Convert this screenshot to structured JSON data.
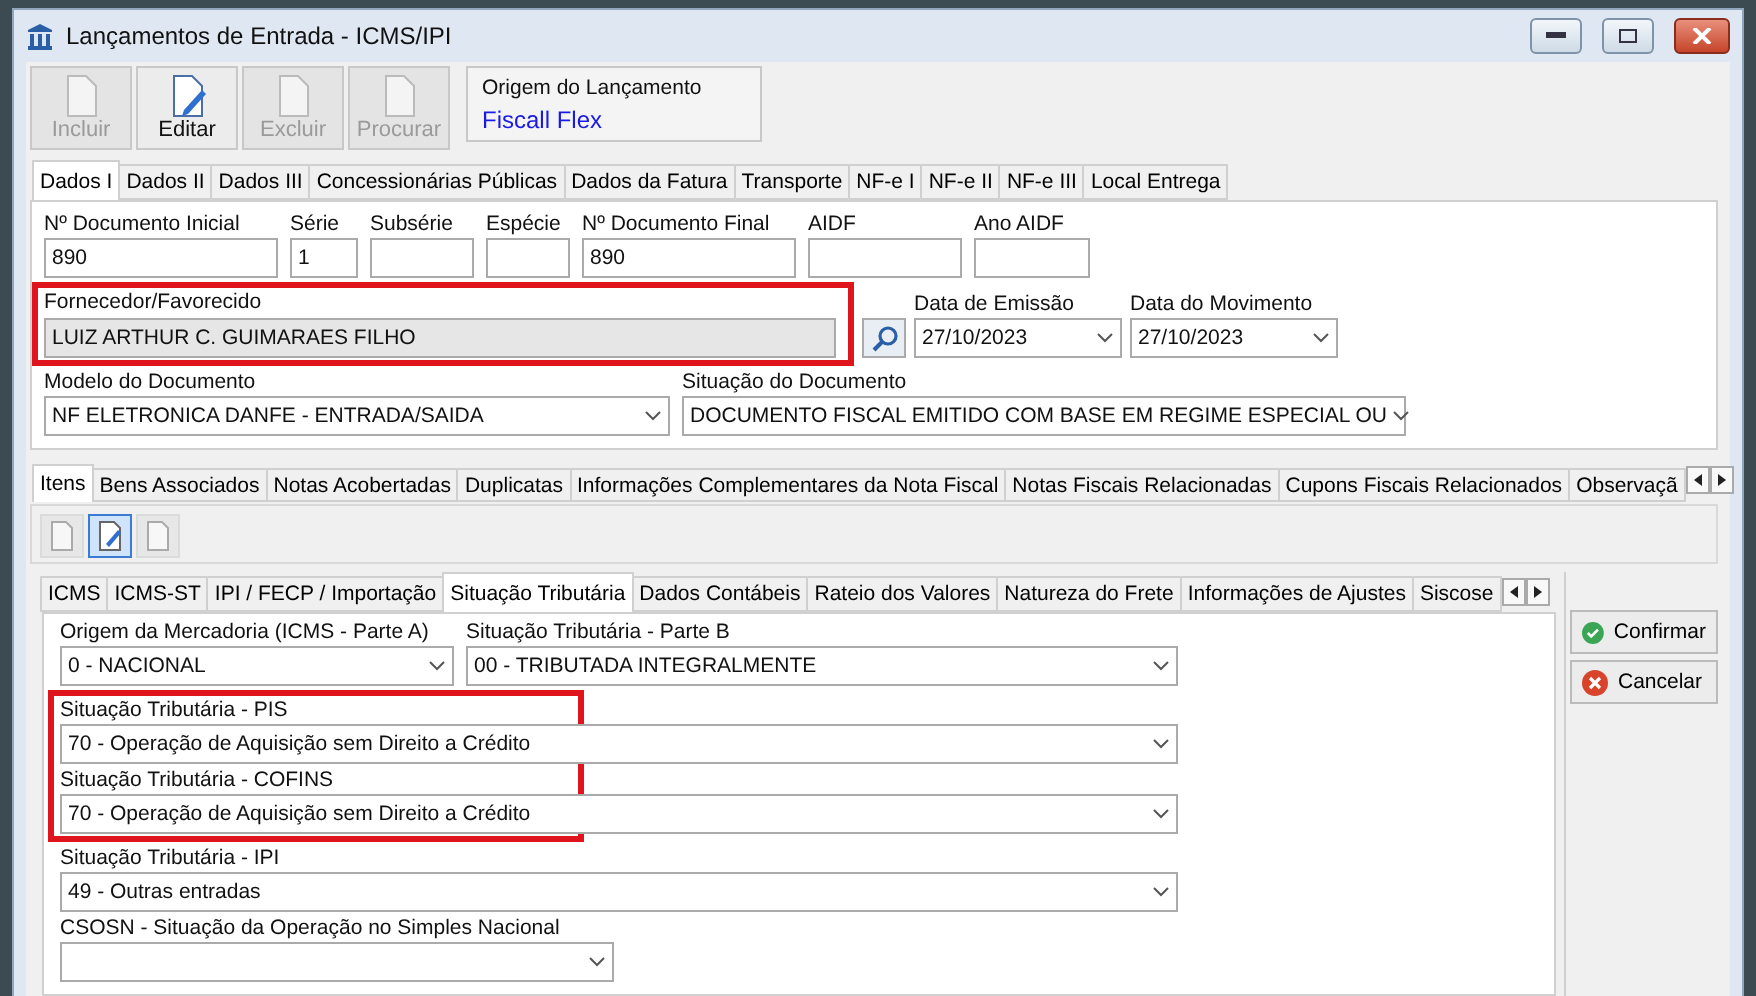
{
  "window": {
    "title": "Lançamentos de Entrada - ICMS/IPI"
  },
  "toolbar": {
    "buttons": [
      {
        "label": "Incluir",
        "disabled": true
      },
      {
        "label": "Editar",
        "disabled": false
      },
      {
        "label": "Excluir",
        "disabled": true
      },
      {
        "label": "Procurar",
        "disabled": true
      }
    ],
    "origin": {
      "label": "Origem do Lançamento",
      "value": "Fiscall Flex"
    }
  },
  "main_tabs": [
    {
      "label": "Dados I",
      "selected": true
    },
    {
      "label": "Dados II",
      "selected": false
    },
    {
      "label": "Dados III",
      "selected": false
    },
    {
      "label": "Concessionárias Públicas",
      "selected": false
    },
    {
      "label": "Dados da Fatura",
      "selected": false
    },
    {
      "label": "Transporte",
      "selected": false
    },
    {
      "label": "NF-e I",
      "selected": false
    },
    {
      "label": "NF-e II",
      "selected": false
    },
    {
      "label": "NF-e III",
      "selected": false
    },
    {
      "label": "Local Entrega",
      "selected": false
    }
  ],
  "document_fields": [
    {
      "label": "Nº Documento Inicial",
      "value": "890"
    },
    {
      "label": "Série",
      "value": "1"
    },
    {
      "label": "Subsérie"
    },
    {
      "label": "Espécie"
    },
    {
      "label": "Nº Documento Final",
      "value": "890"
    },
    {
      "label": "AIDF"
    },
    {
      "label": "Ano AIDF"
    }
  ],
  "supplier": {
    "label": "Fornecedor/Favorecido",
    "value": "LUIZ ARTHUR C. GUIMARAES FILHO",
    "highlighted": true
  },
  "dates": [
    {
      "label": "Data de Emissão",
      "value": "27/10/2023"
    },
    {
      "label": "Data do Movimento",
      "value": "27/10/2023"
    }
  ],
  "document_selects": [
    {
      "label": "Modelo do Documento",
      "value": "NF ELETRONICA DANFE - ENTRADA/SAIDA"
    },
    {
      "label": "Situação do Documento",
      "value": "DOCUMENTO FISCAL EMITIDO COM BASE EM REGIME ESPECIAL OU"
    }
  ],
  "item_tabs": [
    {
      "label": "Itens",
      "selected": true
    },
    {
      "label": "Bens Associados",
      "selected": false
    },
    {
      "label": "Notas Acobertadas",
      "selected": false
    },
    {
      "label": "Duplicatas",
      "selected": false
    },
    {
      "label": "Informações Complementares da Nota Fiscal",
      "selected": false
    },
    {
      "label": "Notas Fiscais Relacionadas",
      "selected": false
    },
    {
      "label": "Cupons Fiscais Relacionados",
      "selected": false
    },
    {
      "label": "Observaçã",
      "selected": false
    }
  ],
  "item_tools": [
    {
      "disabled": true,
      "selected": false
    },
    {
      "disabled": false,
      "selected": true
    },
    {
      "disabled": true,
      "selected": false
    }
  ],
  "tax_tabs": [
    {
      "label": "ICMS",
      "selected": false
    },
    {
      "label": "ICMS-ST",
      "selected": false
    },
    {
      "label": "IPI / FECP / Importação",
      "selected": false
    },
    {
      "label": "Situação Tributária",
      "selected": true
    },
    {
      "label": "Dados Contábeis",
      "selected": false
    },
    {
      "label": "Rateio dos Valores",
      "selected": false
    },
    {
      "label": "Natureza do Frete",
      "selected": false
    },
    {
      "label": "Informações de Ajustes",
      "selected": false
    },
    {
      "label": "Siscose",
      "selected": false
    }
  ],
  "tax_top": [
    {
      "label": "Origem da Mercadoria (ICMS - Parte A)",
      "value": "0 - NACIONAL"
    },
    {
      "label": "Situação Tributária - Parte B",
      "value": "00 - TRIBUTADA INTEGRALMENTE"
    }
  ],
  "tax_highlight": {
    "highlighted": true,
    "fields": [
      {
        "label": "Situação Tributária - PIS",
        "value": "70 - Operação de Aquisição sem Direito a Crédito"
      },
      {
        "label": "Situação Tributária - COFINS",
        "value": "70 - Operação de Aquisição sem Direito a Crédito"
      }
    ]
  },
  "tax_bottom": [
    {
      "label": "Situação Tributária - IPI",
      "value": "49 - Outras entradas"
    },
    {
      "label": "CSOSN - Situação da Operação no Simples Nacional"
    }
  ],
  "actions": [
    {
      "kind": "confirm",
      "label": "Confirmar"
    },
    {
      "kind": "cancel",
      "label": "Cancelar"
    }
  ]
}
